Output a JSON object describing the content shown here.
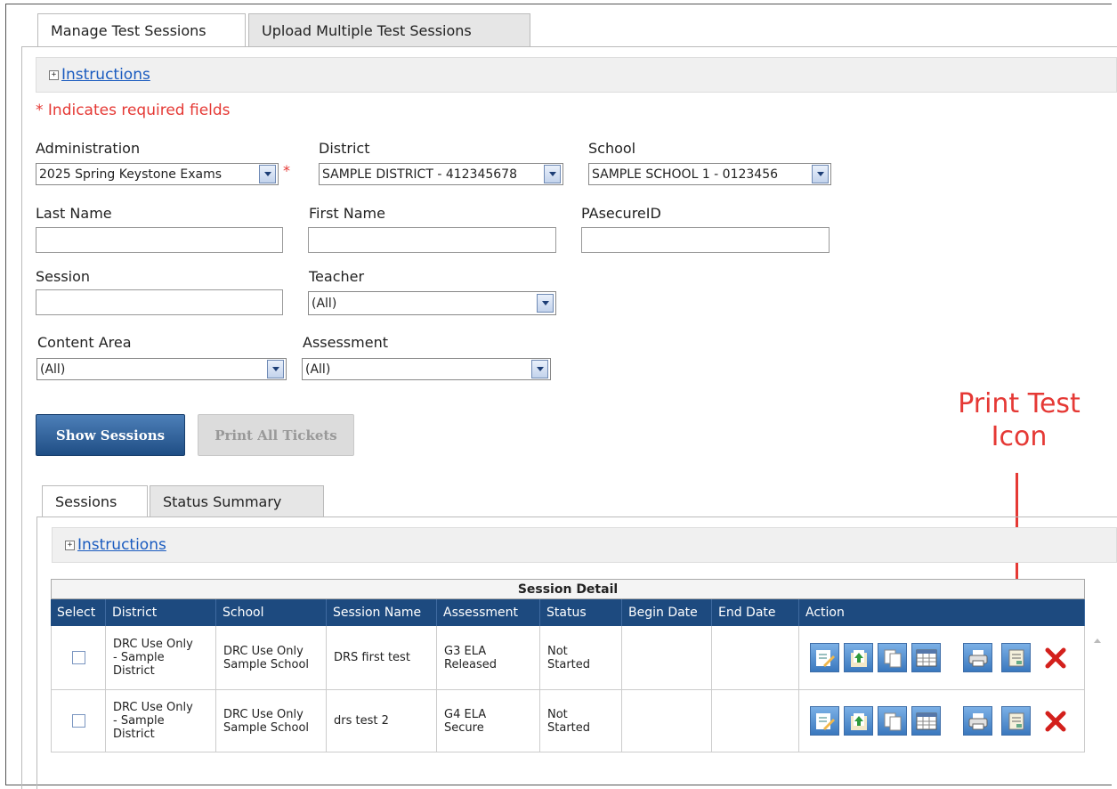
{
  "tabs": {
    "manage": "Manage Test Sessions",
    "upload": "Upload Multiple Test Sessions"
  },
  "instructions_link": "Instructions",
  "required_note": "* Indicates required fields",
  "filters": {
    "administration": {
      "label": "Administration",
      "value": "2025 Spring Keystone Exams"
    },
    "district": {
      "label": "District",
      "value": "SAMPLE DISTRICT - 412345678"
    },
    "school": {
      "label": "School",
      "value": "SAMPLE SCHOOL 1 - 0123456"
    },
    "last_name": {
      "label": "Last Name"
    },
    "first_name": {
      "label": "First Name"
    },
    "pasecure_id": {
      "label": "PAsecureID"
    },
    "session": {
      "label": "Session"
    },
    "teacher": {
      "label": "Teacher",
      "value": "(All)"
    },
    "content_area": {
      "label": "Content Area",
      "value": "(All)"
    },
    "assessment": {
      "label": "Assessment",
      "value": "(All)"
    },
    "required_star": "*"
  },
  "buttons": {
    "show_sessions": "Show Sessions",
    "print_all_tickets": "Print All Tickets"
  },
  "annotation": {
    "line1": "Print Test",
    "line2": "Icon"
  },
  "sub_tabs": {
    "sessions": "Sessions",
    "status_summary": "Status Summary"
  },
  "sub_instructions_link": "Instructions",
  "grid": {
    "title": "Session Detail",
    "columns": [
      "Select",
      "District",
      "School",
      "Session Name",
      "Assessment",
      "Status",
      "Begin Date",
      "End Date",
      "Action"
    ],
    "rows": [
      {
        "district": [
          "DRC Use Only",
          "- Sample",
          "District"
        ],
        "school": [
          "DRC Use Only",
          "Sample School"
        ],
        "session_name": "DRS first test",
        "assessment": [
          "G3 ELA",
          "Released"
        ],
        "status": [
          "Not",
          "Started"
        ],
        "begin_date": "",
        "end_date": ""
      },
      {
        "district": [
          "DRC Use Only",
          "- Sample",
          "District"
        ],
        "school": [
          "DRC Use Only",
          "Sample School"
        ],
        "session_name": "drs test 2",
        "assessment": [
          "G4 ELA",
          "Secure"
        ],
        "status": [
          "Not",
          "Started"
        ],
        "begin_date": "",
        "end_date": ""
      }
    ],
    "action_icons": [
      "edit-icon",
      "import-students-icon",
      "copy-icon",
      "roster-table-icon",
      "print-icon",
      "print-test-icon",
      "delete-icon"
    ]
  }
}
